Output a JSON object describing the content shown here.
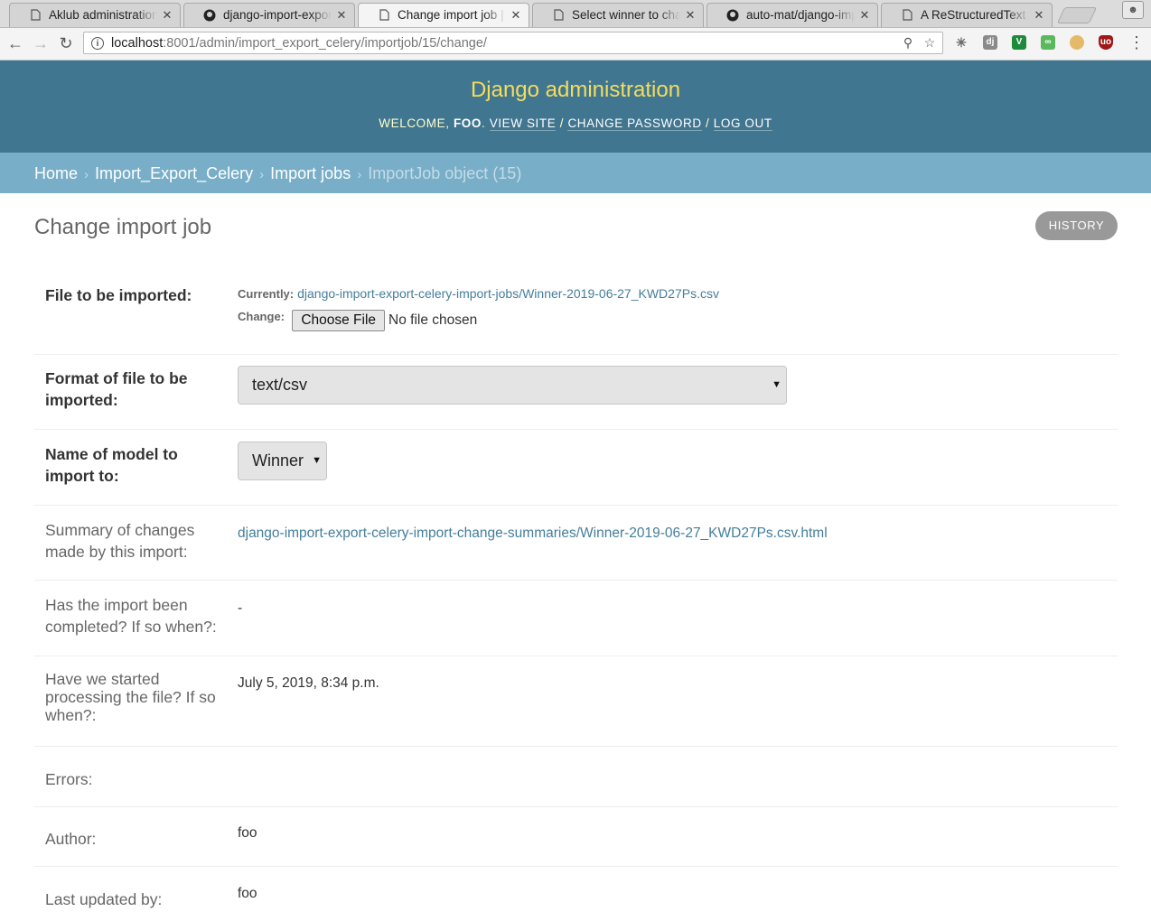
{
  "browser": {
    "tabs": [
      {
        "title": "Aklub administration",
        "icon": "page-icon",
        "active": false
      },
      {
        "title": "django-import-export",
        "icon": "github-icon",
        "active": false
      },
      {
        "title": "Change import job | D",
        "icon": "page-icon",
        "active": true
      },
      {
        "title": "Select winner to change",
        "icon": "page-icon",
        "active": false
      },
      {
        "title": "auto-mat/django-imp",
        "icon": "github-icon",
        "active": false
      },
      {
        "title": "A ReStructuredText P",
        "icon": "page-icon",
        "active": false
      }
    ],
    "url_host": "localhost",
    "url_rest": ":8001/admin/import_export_celery/importjob/15/change/"
  },
  "header": {
    "site_title": "Django administration",
    "welcome": "Welcome,",
    "username": "foo",
    "view_site": "View site",
    "change_password": "Change password",
    "log_out": "Log out",
    "header_bg": "#417690",
    "title_color": "#f5dd5d"
  },
  "breadcrumbs": {
    "home": "Home",
    "app": "Import_Export_Celery",
    "model": "Import jobs",
    "current": "ImportJob object (15)"
  },
  "page": {
    "title": "Change import job",
    "history": "History"
  },
  "form": {
    "file": {
      "label": "File to be imported:",
      "currently_label": "Currently:",
      "current_file": "django-import-export-celery-import-jobs/Winner-2019-06-27_KWD27Ps.csv",
      "change_label": "Change:",
      "choose_button": "Choose File",
      "no_file": "No file chosen"
    },
    "format": {
      "label": "Format of file to be imported:",
      "value": "text/csv"
    },
    "model": {
      "label": "Name of model to import to:",
      "value": "Winner"
    },
    "summary": {
      "label": "Summary of changes made by this import:",
      "value": "django-import-export-celery-import-change-summaries/Winner-2019-06-27_KWD27Ps.csv.html"
    },
    "completed": {
      "label": "Has the import been completed? If so when?:",
      "value": "-"
    },
    "started": {
      "label": "Have we started processing the file? If so when?:",
      "value": "July 5, 2019, 8:34 p.m."
    },
    "errors": {
      "label": "Errors:",
      "value": ""
    },
    "author": {
      "label": "Author:",
      "value": "foo"
    },
    "updated_by": {
      "label": "Last updated by:",
      "value": "foo"
    }
  }
}
